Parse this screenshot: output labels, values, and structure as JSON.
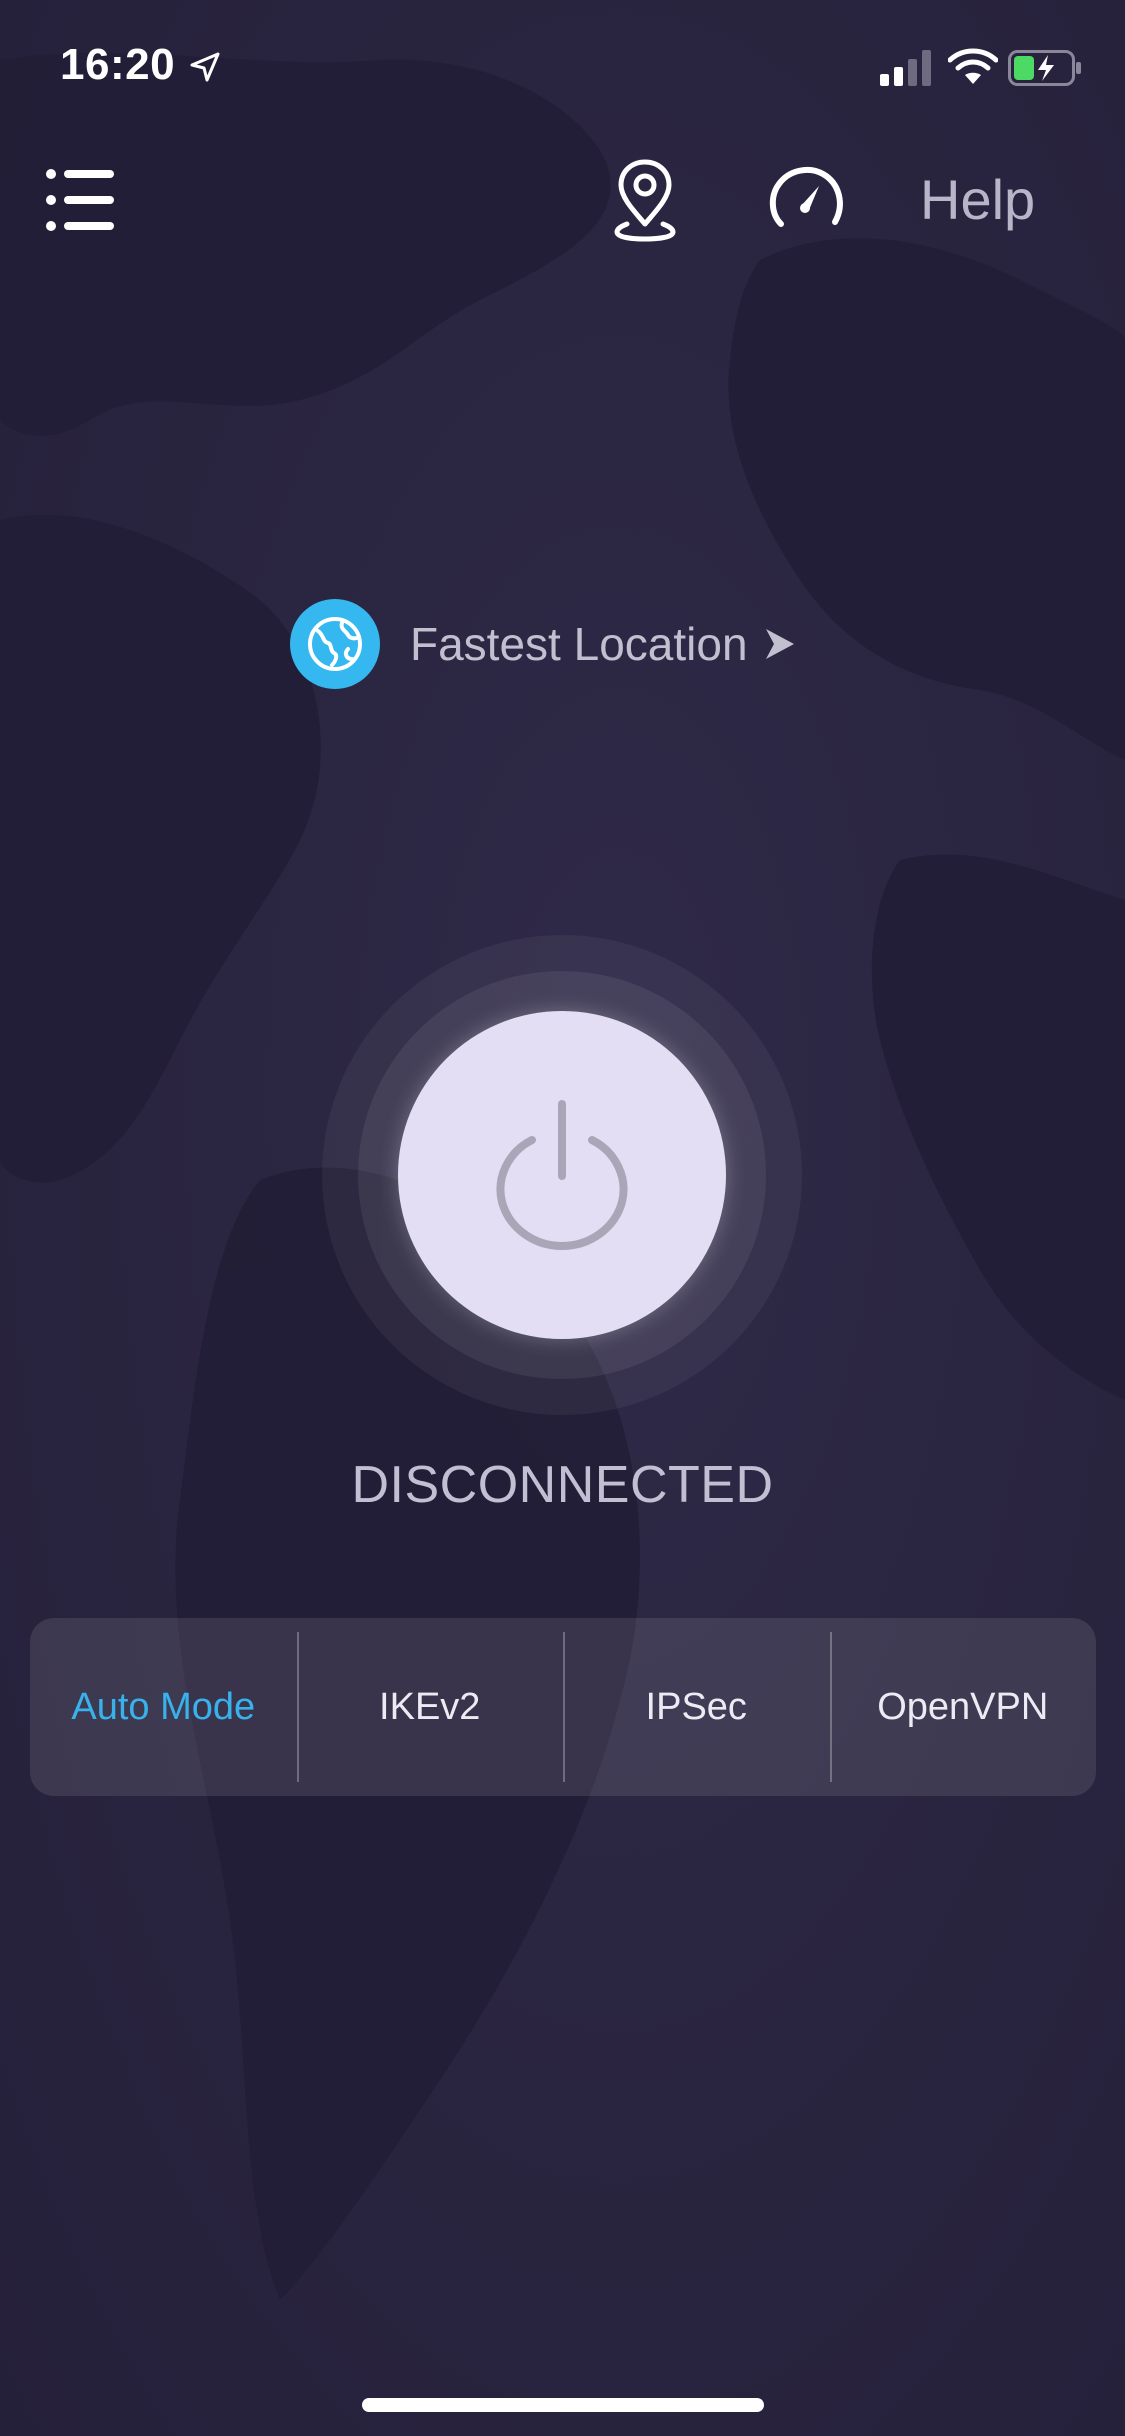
{
  "status_bar": {
    "time": "16:20"
  },
  "nav": {
    "help_label": "Help"
  },
  "location": {
    "label": "Fastest Location"
  },
  "connection": {
    "status": "DISCONNECTED"
  },
  "protocols": [
    {
      "label": "Auto Mode",
      "active": true
    },
    {
      "label": "IKEv2",
      "active": false
    },
    {
      "label": "IPSec",
      "active": false
    },
    {
      "label": "OpenVPN",
      "active": false
    }
  ],
  "colors": {
    "background": "#2a2540",
    "accent": "#38b2ec",
    "globe": "#35b8f0",
    "power_button": "#e3def3",
    "battery_green": "#4cd964"
  },
  "icons": {
    "menu": "menu-icon",
    "location_pin": "location-pin-icon",
    "speed_test": "speedometer-icon",
    "globe": "globe-icon",
    "power": "power-icon"
  }
}
